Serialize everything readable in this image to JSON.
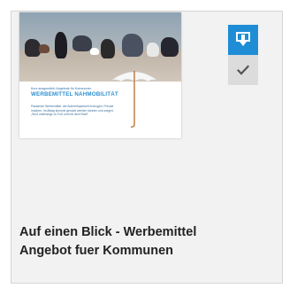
{
  "card": {
    "title_line1": "Auf einen Blick - Werbemittel",
    "title_line2": "Angebot fuer Kommunen"
  },
  "thumbnail": {
    "subtitle": "Kurz ausgewählt: Angebote für Kommunen",
    "headline": "WERBEMITTEL NAHMOBILITÄT",
    "body1": "Passende Werbemittel, die Aufmerksamkeit erzeugen: Freude",
    "body2": "machen, im Alltag sinnvoll genutzt werden können und zeigen:",
    "body3": "„Sind unterwegs zu Fuß und mit dem Rad!“"
  },
  "actions": {
    "download_icon": "download-icon",
    "check_icon": "check-icon"
  },
  "colors": {
    "accent": "#1f8dd6",
    "card_bg": "#f2f2f2",
    "check_bg": "#dcdcdc"
  }
}
